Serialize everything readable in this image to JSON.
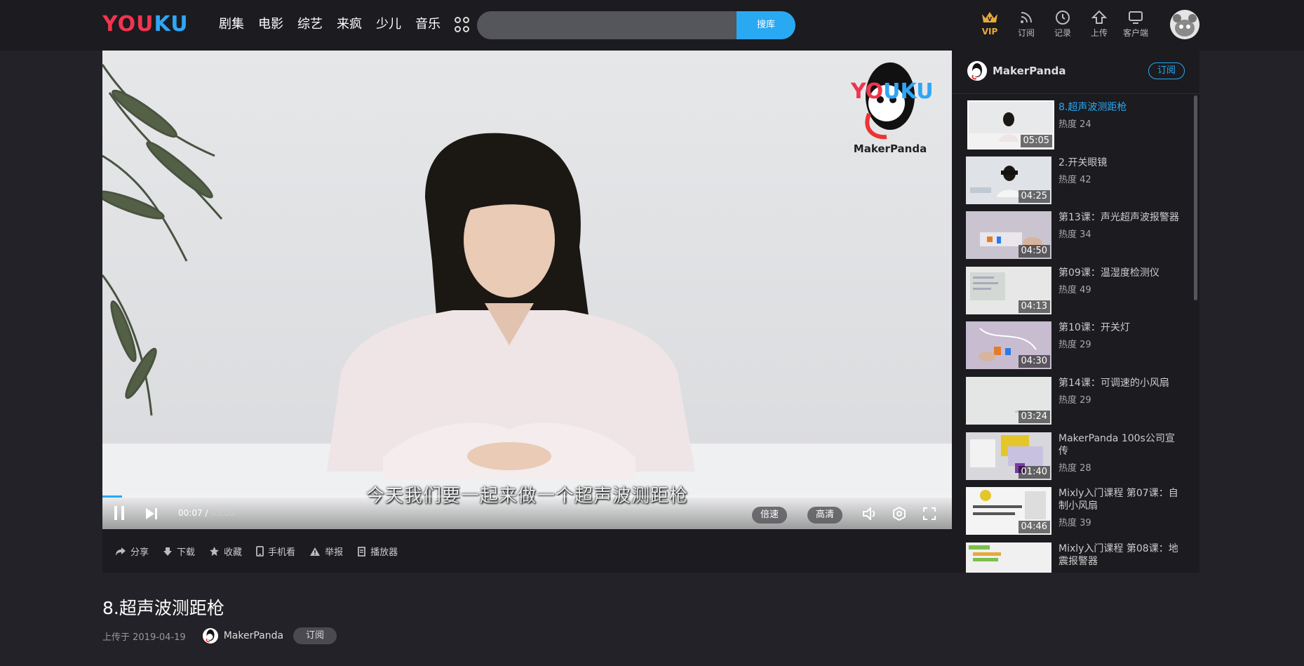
{
  "header": {
    "logo": {
      "you": "YOU",
      "ku": "KU"
    },
    "nav": [
      "剧集",
      "电影",
      "综艺",
      "来疯",
      "少儿",
      "音乐"
    ],
    "search": {
      "placeholder": "",
      "button": "搜库"
    },
    "tools": [
      {
        "label": "VIP",
        "icon": "crown-icon"
      },
      {
        "label": "订阅",
        "icon": "rss-icon"
      },
      {
        "label": "记录",
        "icon": "clock-icon"
      },
      {
        "label": "上传",
        "icon": "upload-icon"
      },
      {
        "label": "客户端",
        "icon": "monitor-icon"
      }
    ]
  },
  "player": {
    "watermark": {
      "logo_you": "YO",
      "logo_ku": "UKU",
      "text": "MakerPanda"
    },
    "subtitle": "今天我们要一起来做一个超声波测距枪",
    "current_time": "00:07",
    "duration": "05:05",
    "progress_fraction": 0.023,
    "speed_label": "倍速",
    "quality_label": "高清"
  },
  "actions": [
    "分享",
    "下载",
    "收藏",
    "手机看",
    "举报",
    "播放器"
  ],
  "sidebar": {
    "channel": "MakerPanda",
    "subscribe": "订阅",
    "items": [
      {
        "title": "8.超声波测距枪",
        "heat": "热度 24",
        "duration": "05:05",
        "active": true
      },
      {
        "title": "2.开关眼镜",
        "heat": "热度 42",
        "duration": "04:25"
      },
      {
        "title": "第13课：声光超声波报警器",
        "heat": "热度 34",
        "duration": "04:50"
      },
      {
        "title": "第09课：温湿度检测仪",
        "heat": "热度 49",
        "duration": "04:13"
      },
      {
        "title": "第10课：开关灯",
        "heat": "热度 29",
        "duration": "04:30"
      },
      {
        "title": "第14课：可调速的小风扇",
        "heat": "热度 29",
        "duration": "03:24"
      },
      {
        "title": "MakerPanda 100s公司宣传",
        "heat": "热度 28",
        "duration": "01:40"
      },
      {
        "title": "Mixly入门课程 第07课：自制小风扇",
        "heat": "热度 39",
        "duration": "04:46"
      },
      {
        "title": "Mixly入门课程 第08课：地震报警器",
        "heat": "",
        "duration": ""
      }
    ]
  },
  "video": {
    "title": "8.超声波测距枪",
    "upload": "上传于 2019-04-19",
    "uploader": "MakerPanda",
    "subscribe": "订阅"
  },
  "colors": {
    "accent": "#2aa9f3",
    "bg": "#222228",
    "panel": "#1b1b20",
    "vip": "#e8a93a",
    "brand_red": "#f0354f"
  }
}
